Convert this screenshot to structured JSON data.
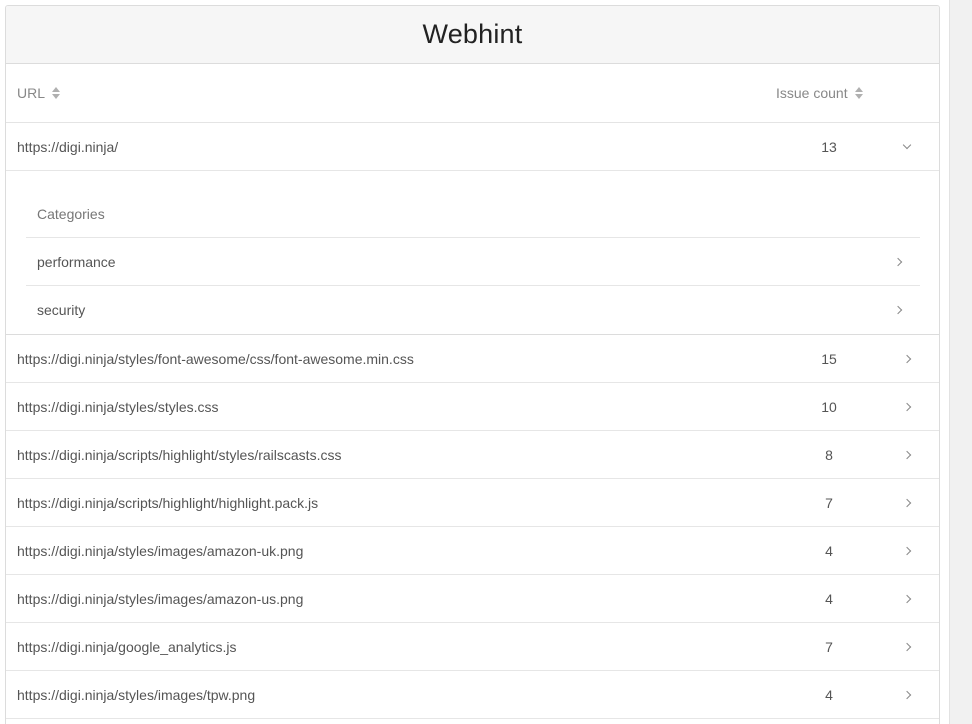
{
  "header": {
    "title": "Webhint"
  },
  "table": {
    "columns": {
      "url": "URL",
      "issue_count": "Issue count"
    },
    "expanded_row": {
      "url": "https://digi.ninja/",
      "count": "13",
      "categories_label": "Categories",
      "categories": [
        "performance",
        "security"
      ]
    },
    "rows": [
      {
        "url": "https://digi.ninja/styles/font-awesome/css/font-awesome.min.css",
        "count": "15"
      },
      {
        "url": "https://digi.ninja/styles/styles.css",
        "count": "10"
      },
      {
        "url": "https://digi.ninja/scripts/highlight/styles/railscasts.css",
        "count": "8"
      },
      {
        "url": "https://digi.ninja/scripts/highlight/highlight.pack.js",
        "count": "7"
      },
      {
        "url": "https://digi.ninja/styles/images/amazon-uk.png",
        "count": "4"
      },
      {
        "url": "https://digi.ninja/styles/images/amazon-us.png",
        "count": "4"
      },
      {
        "url": "https://digi.ninja/google_analytics.js",
        "count": "7"
      },
      {
        "url": "https://digi.ninja/styles/images/tpw.png",
        "count": "4"
      }
    ]
  }
}
